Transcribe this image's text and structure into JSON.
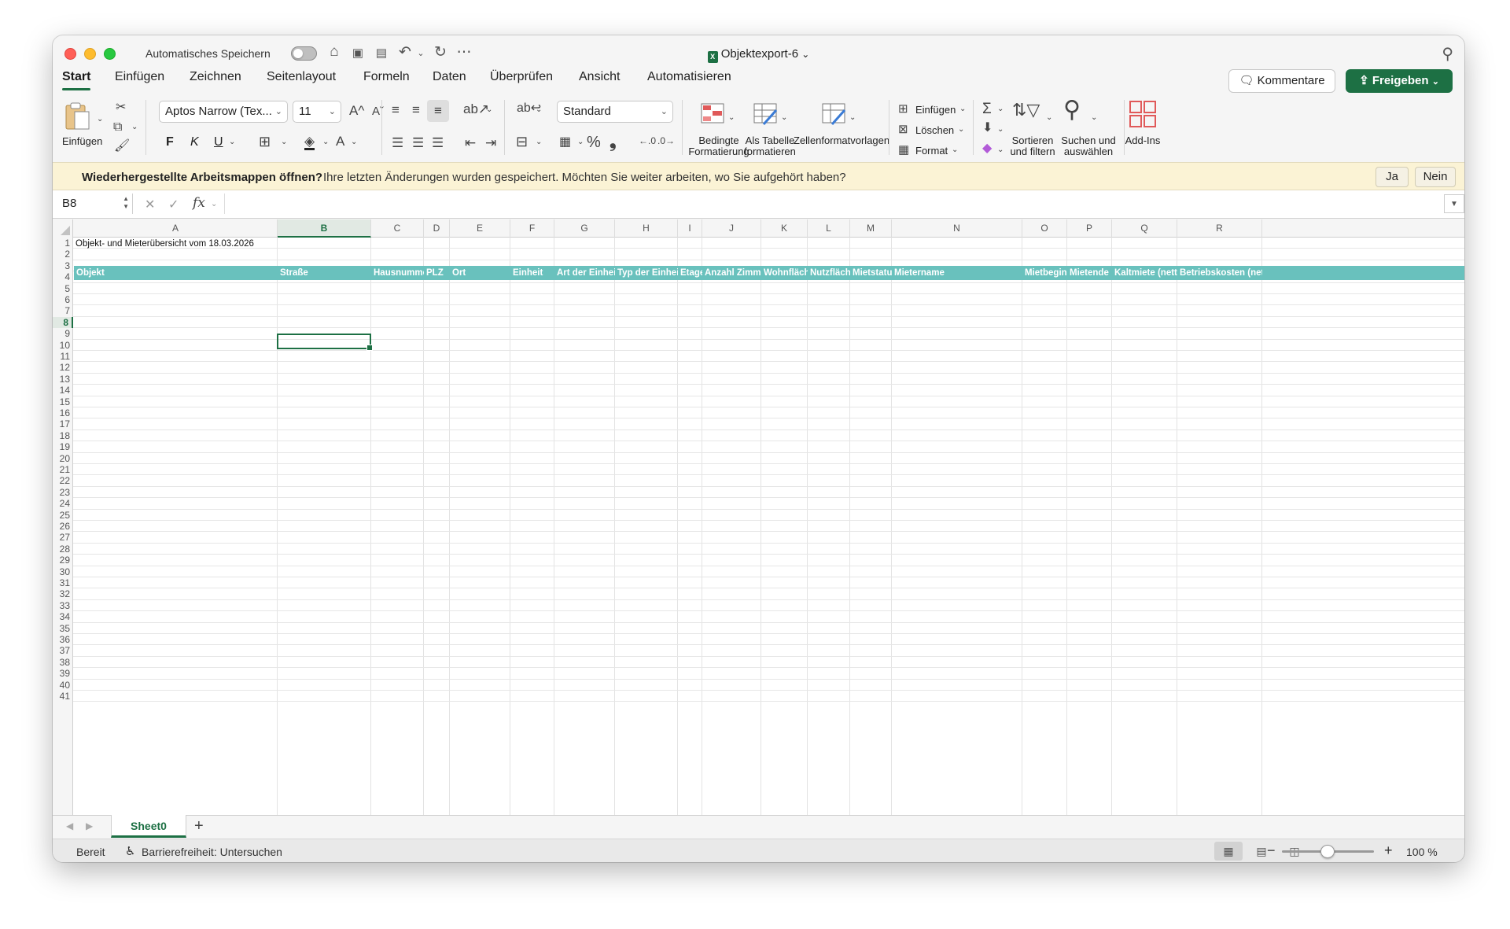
{
  "title_bar": {
    "autosave_label": "Automatisches Speichern",
    "document_title": "Objektexport-6",
    "document_title_chevron": "⌄",
    "icons": [
      "home-icon",
      "save-icon",
      "save-as-icon",
      "undo-icon",
      "redo-icon",
      "more-icon",
      "search-icon"
    ]
  },
  "menu": {
    "tabs": [
      "Start",
      "Einfügen",
      "Zeichnen",
      "Seitenlayout",
      "Formeln",
      "Daten",
      "Überprüfen",
      "Ansicht",
      "Automatisieren"
    ],
    "active": "Start",
    "comments_label": "Kommentare",
    "share_label": "Freigeben"
  },
  "ribbon": {
    "paste_label": "Einfügen",
    "font_name": "Aptos Narrow (Tex...",
    "font_size": "11",
    "bold": "F",
    "italic": "K",
    "underline": "U",
    "grow_font": "A^",
    "shrink_font": "Aˇ",
    "number_format": "Standard",
    "percent": "%",
    "thousands": "❟",
    "conditional_formatting": [
      "Bedingte",
      "Formatierung"
    ],
    "format_as_table": [
      "Als Tabelle",
      "formatieren"
    ],
    "cell_styles": "Zellenformatvorlagen",
    "insert_label": "Einfügen",
    "delete_label": "Löschen",
    "format_label": "Format",
    "sort_filter": [
      "Sortieren",
      "und filtern"
    ],
    "find_select": [
      "Suchen und",
      "auswählen"
    ],
    "addins": "Add-Ins",
    "accent": "#1d7044"
  },
  "infobar": {
    "bold_text": "Wiederhergestellte Arbeitsmappen öffnen?",
    "text": "Ihre letzten Änderungen wurden gespeichert. Möchten Sie weiter arbeiten, wo Sie aufgehört haben?",
    "yes_label": "Ja",
    "no_label": "Nein"
  },
  "formula_bar": {
    "name_box": "B8",
    "formula": ""
  },
  "sheet": {
    "columns": [
      "A",
      "B",
      "C",
      "D",
      "E",
      "F",
      "G",
      "H",
      "I",
      "J",
      "K",
      "L",
      "M",
      "N",
      "O",
      "P",
      "Q",
      "R"
    ],
    "selected_column": "B",
    "selected_row": 8,
    "row_count": 41,
    "title_cell": "Objekt- und Mieterübersicht vom 18.03.2026",
    "headers": [
      "Objekt",
      "Straße",
      "Hausnummer",
      "PLZ",
      "Ort",
      "Einheit",
      "Art der Einheit",
      "Typ der Einheit",
      "Etage",
      "Anzahl Zimmer",
      "Wohnfläche",
      "Nutzfläche",
      "Mietstatus",
      "Mietername",
      "Mietbeginn",
      "Mietende",
      "Kaltmiete (netto)",
      "Betriebskosten (netto)"
    ],
    "header_color": "#69c1bd"
  },
  "sheet_tabs": {
    "tabs": [
      "Sheet0"
    ],
    "add_label": "+"
  },
  "status_bar": {
    "ready": "Bereit",
    "accessibility": "Barrierefreiheit: Untersuchen",
    "zoom": "100 %"
  }
}
